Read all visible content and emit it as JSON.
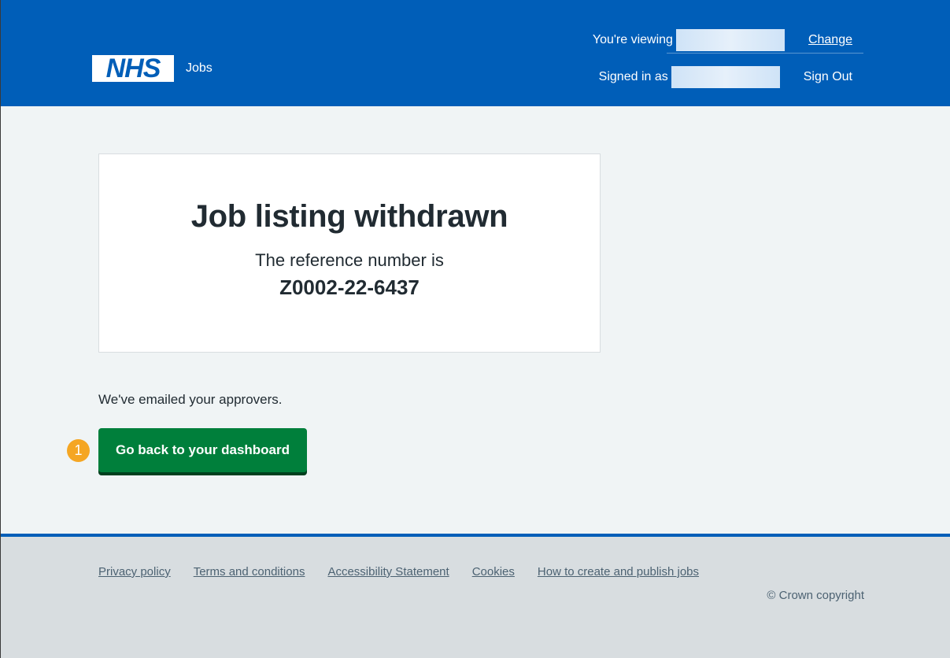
{
  "header": {
    "logo_text": "NHS",
    "service_name": "Jobs",
    "viewing_label": "You're viewing",
    "change_link": "Change",
    "signed_in_label": "Signed in as",
    "sign_out_link": "Sign Out"
  },
  "panel": {
    "title": "Job listing withdrawn",
    "body": "The reference number is",
    "reference": "Z0002-22-6437"
  },
  "main": {
    "info_text": "We've emailed your approvers.",
    "step_badge": "1",
    "primary_button": "Go back to your dashboard"
  },
  "footer": {
    "links": [
      "Privacy policy",
      "Terms and conditions",
      "Accessibility Statement",
      "Cookies",
      "How to create and publish jobs"
    ],
    "copyright": "© Crown copyright"
  },
  "colors": {
    "header_blue": "#005eb8",
    "button_green": "#007f3b",
    "badge_orange": "#f5a623",
    "page_bg": "#f0f4f5",
    "footer_bg": "#d8dde0"
  }
}
